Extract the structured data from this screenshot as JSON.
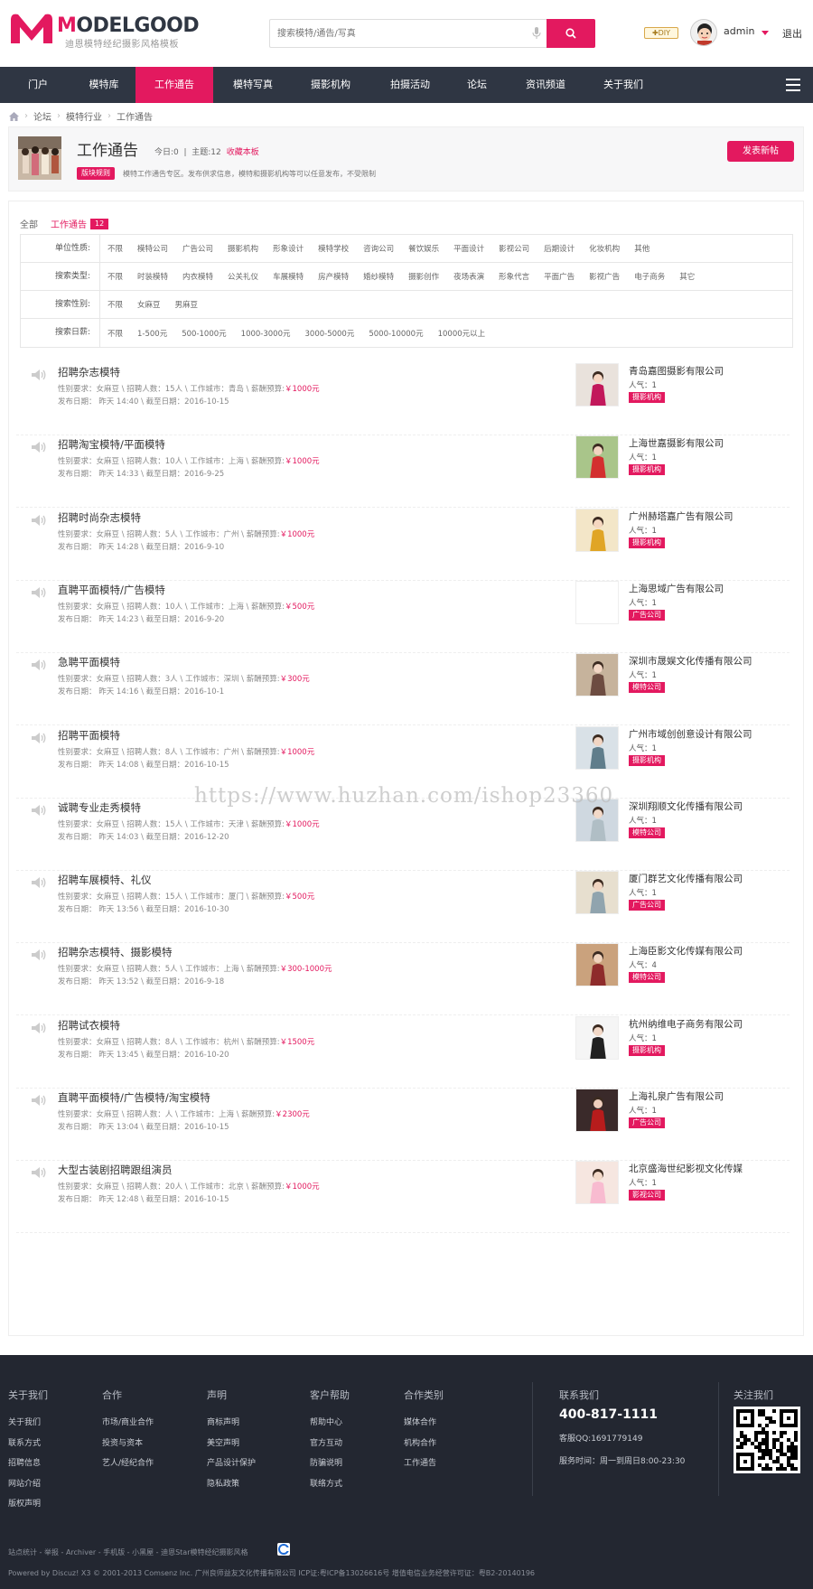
{
  "brand": {
    "logo_text_m": "M",
    "logo_text_rest": "ODELGOOD",
    "logo_subtitle": "迪恩模特经纪摄影风格模板"
  },
  "header": {
    "search_placeholder": "搜索模特/通告/写真",
    "diy_label": "✚DIY",
    "username": "admin",
    "logout": "退出"
  },
  "nav": {
    "items": [
      "门户",
      "模特库",
      "工作通告",
      "模特写真",
      "摄影机构",
      "拍摄活动",
      "论坛",
      "资讯频道",
      "关于我们"
    ],
    "active": "工作通告"
  },
  "breadcrumb": [
    "论坛",
    "模特行业",
    "工作通告"
  ],
  "forum": {
    "title": "工作通告",
    "today": "今日:0",
    "topics": "主题:12",
    "favorite": "收藏本板",
    "rules_label": "版块规则",
    "description": "模特工作通告专区。发布供求信息，模特和摄影机构等可以任意发布，不受限制",
    "post_button": "发表新帖"
  },
  "tabs": {
    "all": "全部",
    "current": "工作通告",
    "count": "12"
  },
  "filters": [
    {
      "label": "单位性质:",
      "options": [
        "不限",
        "模特公司",
        "广告公司",
        "摄影机构",
        "形象设计",
        "模特学校",
        "咨询公司",
        "餐饮娱乐",
        "平面设计",
        "影视公司",
        "后期设计",
        "化妆机构",
        "其他"
      ]
    },
    {
      "label": "搜索类型:",
      "options": [
        "不限",
        "时装模特",
        "内衣模特",
        "公关礼仪",
        "车展模特",
        "房产模特",
        "婚纱模特",
        "摄影创作",
        "夜场表演",
        "形象代言",
        "平面广告",
        "影视广告",
        "电子商务",
        "其它"
      ]
    },
    {
      "label": "搜索性别:",
      "options": [
        "不限",
        "女麻豆",
        "男麻豆"
      ]
    },
    {
      "label": "搜索日薪:",
      "options": [
        "不限",
        "1-500元",
        "500-1000元",
        "1000-3000元",
        "3000-5000元",
        "5000-10000元",
        "10000元以上"
      ]
    }
  ],
  "threads": [
    {
      "title": "招聘杂志模特",
      "req": "性别要求：女麻豆 \\ 招聘人数：15人 \\ 工作城市：青岛 \\ 薪酬预算:",
      "pay": "￥1000元",
      "date": "发布日期： 昨天 14:40  \\ 截至日期：2016-10-15",
      "company": "青岛嘉图摄影有限公司",
      "pop": "人气：1",
      "tag": "摄影机构"
    },
    {
      "title": "招聘淘宝模特/平面模特",
      "req": "性别要求：女麻豆 \\ 招聘人数：10人 \\ 工作城市：上海 \\ 薪酬预算:",
      "pay": "￥1000元",
      "date": "发布日期： 昨天 14:33  \\ 截至日期：2016-9-25",
      "company": "上海世嘉摄影有限公司",
      "pop": "人气：1",
      "tag": "摄影机构"
    },
    {
      "title": "招聘时尚杂志模特",
      "req": "性别要求：女麻豆 \\ 招聘人数：5人 \\ 工作城市：广州 \\ 薪酬预算:",
      "pay": "￥1000元",
      "date": "发布日期： 昨天 14:28  \\ 截至日期：2016-9-10",
      "company": "广州赫塔嘉广告有限公司",
      "pop": "人气：1",
      "tag": "摄影机构"
    },
    {
      "title": "直聘平面模特/广告模特",
      "req": "性别要求：女麻豆 \\ 招聘人数：10人 \\ 工作城市：上海 \\ 薪酬预算:",
      "pay": "￥500元",
      "date": "发布日期： 昨天 14:23  \\ 截至日期：2016-9-20",
      "company": "上海思域广告有限公司",
      "pop": "人气：1",
      "tag": "广告公司"
    },
    {
      "title": "急聘平面模特",
      "req": "性别要求：女麻豆 \\ 招聘人数：3人 \\ 工作城市：深圳 \\ 薪酬预算:",
      "pay": "￥300元",
      "date": "发布日期： 昨天 14:16  \\ 截至日期：2016-10-1",
      "company": "深圳市晟娱文化传播有限公司",
      "pop": "人气：1",
      "tag": "模特公司"
    },
    {
      "title": "招聘平面模特",
      "req": "性别要求：女麻豆 \\ 招聘人数：8人 \\ 工作城市：广州 \\ 薪酬预算:",
      "pay": "￥1000元",
      "date": "发布日期： 昨天 14:08  \\ 截至日期：2016-10-15",
      "company": "广州市域创创意设计有限公司",
      "pop": "人气：1",
      "tag": "摄影机构"
    },
    {
      "title": "诚聘专业走秀模特",
      "req": "性别要求：女麻豆 \\ 招聘人数：15人 \\ 工作城市：天津 \\ 薪酬预算:",
      "pay": "￥1000元",
      "date": "发布日期： 昨天 14:03  \\ 截至日期：2016-12-20",
      "company": "深圳翔顺文化传播有限公司",
      "pop": "人气：1",
      "tag": "模特公司"
    },
    {
      "title": "招聘车展模特、礼仪",
      "req": "性别要求：女麻豆 \\ 招聘人数：15人 \\ 工作城市：厦门 \\ 薪酬预算:",
      "pay": "￥500元",
      "date": "发布日期： 昨天 13:56  \\ 截至日期：2016-10-30",
      "company": "厦门群艺文化传播有限公司",
      "pop": "人气：1",
      "tag": "广告公司"
    },
    {
      "title": "招聘杂志模特、摄影模特",
      "req": "性别要求：女麻豆 \\ 招聘人数：5人 \\ 工作城市：上海 \\ 薪酬预算:",
      "pay": "￥300-1000元",
      "date": "发布日期： 昨天 13:52  \\ 截至日期：2016-9-18",
      "company": "上海臣影文化传媒有限公司",
      "pop": "人气：4",
      "tag": "模特公司"
    },
    {
      "title": "招聘试衣模特",
      "req": "性别要求：女麻豆 \\ 招聘人数：8人 \\ 工作城市：杭州 \\ 薪酬预算:",
      "pay": "￥1500元",
      "date": "发布日期： 昨天 13:45  \\ 截至日期：2016-10-20",
      "company": "杭州纳维电子商务有限公司",
      "pop": "人气：1",
      "tag": "摄影机构"
    },
    {
      "title": "直聘平面模特/广告模特/淘宝模特",
      "req": "性别要求：女麻豆 \\ 招聘人数：人 \\ 工作城市：上海 \\ 薪酬预算:",
      "pay": "￥2300元",
      "date": "发布日期： 昨天 13:04  \\ 截至日期：2016-10-15",
      "company": "上海礼泉广告有限公司",
      "pop": "人气：1",
      "tag": "广告公司"
    },
    {
      "title": "大型古装剧招聘跟组演员",
      "req": "性别要求：女麻豆 \\ 招聘人数：20人 \\ 工作城市：北京 \\ 薪酬预算:",
      "pay": "￥1000元",
      "date": "发布日期： 昨天 12:48  \\ 截至日期：2016-10-15",
      "company": "北京盛海世纪影视文化传媒",
      "pop": "人气：1",
      "tag": "影视公司"
    }
  ],
  "watermark": "https://www.huzhan.com/ishop23360",
  "footer": {
    "cols": [
      {
        "head": "关于我们",
        "links": [
          "关于我们",
          "联系方式",
          "招聘信息",
          "网站介绍",
          "版权声明"
        ]
      },
      {
        "head": "合作",
        "links": [
          "市场/商业合作",
          "投资与资本",
          "艺人/经纪合作"
        ]
      },
      {
        "head": "声明",
        "links": [
          "商标声明",
          "美空声明",
          "产品设计保护",
          "隐私政策"
        ]
      },
      {
        "head": "客户帮助",
        "links": [
          "帮助中心",
          "官方互动",
          "防骗说明",
          "联络方式"
        ]
      },
      {
        "head": "合作类别",
        "links": [
          "媒体合作",
          "机构合作",
          "工作通告"
        ]
      }
    ],
    "contact_head": "联系我们",
    "phone": "400-817-1111",
    "qq": "客服QQ:1691779149",
    "service_time": "服务时间：周一到周日8:00-23:30",
    "follow_head": "关注我们",
    "bottom1": "站点统计 - 举报 - Archiver - 手机版 - 小黑屋 - 迪恩Star模特经纪摄影风格",
    "bottom2": "Powered by Discuz! X3  © 2001-2013 Comsenz Inc.  广州良师益友文化传播有限公司 ICP证:粤ICP备13026616号 增值电信业务经营许可证：粤B2-20140196"
  },
  "colors": {
    "accent": "#e3195f",
    "nav_bg": "#2f3643",
    "footer_bg": "#232731"
  }
}
